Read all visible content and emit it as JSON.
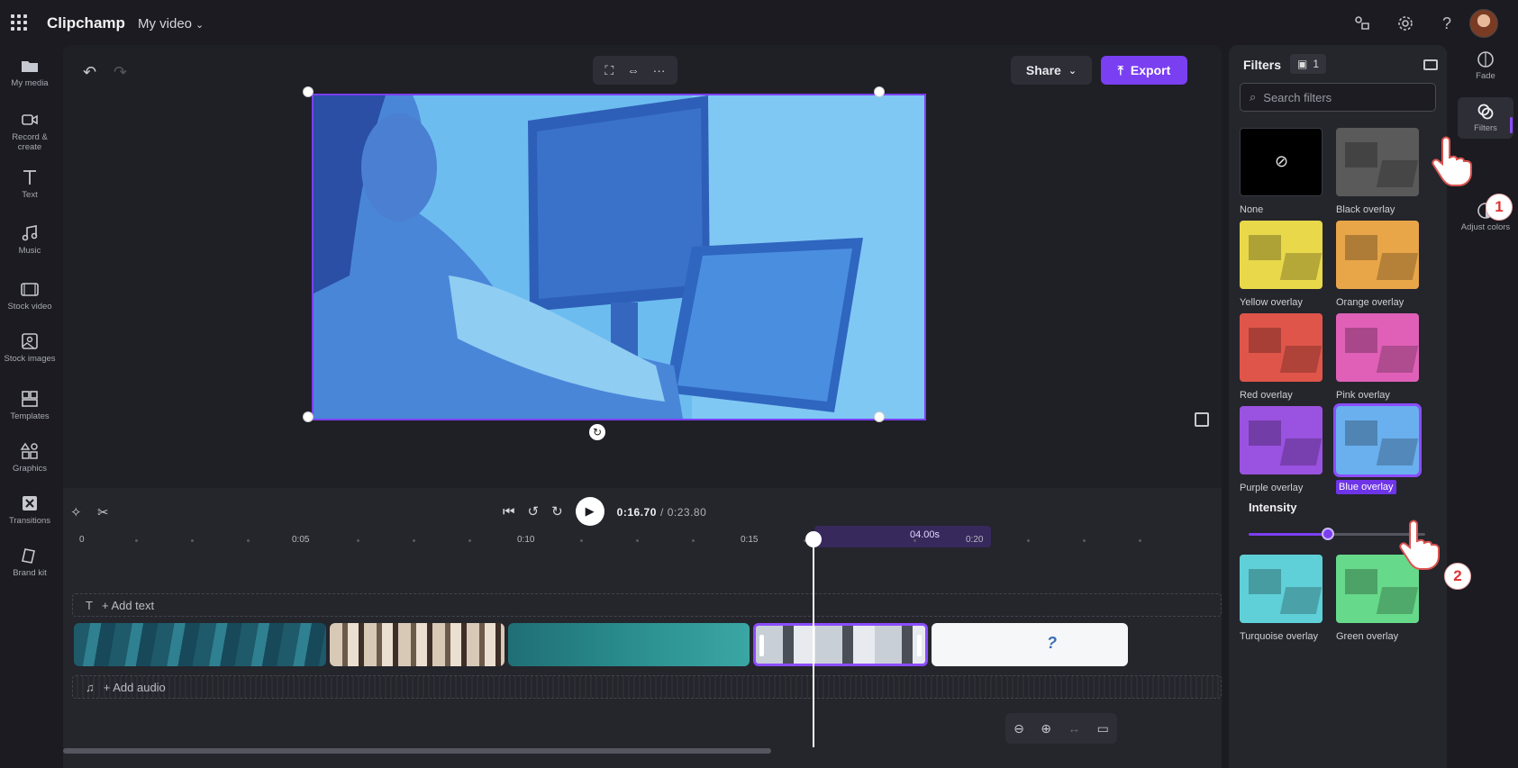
{
  "topbar": {
    "app_title": "Clipchamp",
    "video_title": "My video",
    "icons": [
      "waffle-icon",
      "feedback-icon",
      "settings-icon",
      "help-icon",
      "avatar"
    ]
  },
  "leftnav": {
    "items": [
      {
        "label": "My media",
        "icon": "folder-icon"
      },
      {
        "label": "Record & create",
        "icon": "camera-icon"
      },
      {
        "label": "Text",
        "icon": "text-icon"
      },
      {
        "label": "Music",
        "icon": "music-icon"
      },
      {
        "label": "Stock video",
        "icon": "film-icon"
      },
      {
        "label": "Stock images",
        "icon": "image-icon"
      },
      {
        "label": "Templates",
        "icon": "templates-icon"
      },
      {
        "label": "Graphics",
        "icon": "shapes-icon"
      },
      {
        "label": "Transitions",
        "icon": "transitions-icon"
      },
      {
        "label": "Brand kit",
        "icon": "brand-kit-icon"
      }
    ]
  },
  "stage": {
    "share_label": "Share",
    "export_label": "Export"
  },
  "timeline": {
    "current_time": "0:16.70",
    "total_time": "/ 0:23.80",
    "ruler": [
      "0",
      "0:05",
      "0:10",
      "0:15",
      "0:20"
    ],
    "selection_duration": "04.00s",
    "add_text": "+ Add text",
    "add_audio": "+ Add audio"
  },
  "filters_panel": {
    "title": "Filters",
    "count": "1",
    "search_placeholder": "Search filters",
    "filters": [
      {
        "label": "None",
        "color": "#000000"
      },
      {
        "label": "Black overlay",
        "color": "#5a5a5a"
      },
      {
        "label": "Yellow overlay",
        "color": "#e8d84a"
      },
      {
        "label": "Orange overlay",
        "color": "#e8a648"
      },
      {
        "label": "Red overlay",
        "color": "#e0554a"
      },
      {
        "label": "Pink overlay",
        "color": "#e060b8"
      },
      {
        "label": "Purple overlay",
        "color": "#9a52e0"
      },
      {
        "label": "Blue overlay",
        "color": "#6ab0ef"
      },
      {
        "label": "Turquoise overlay",
        "color": "#5fd0d8"
      },
      {
        "label": "Green overlay",
        "color": "#66d98a"
      }
    ],
    "selected_filter": "Blue overlay",
    "intensity_label": "Intensity",
    "intensity_value": 0.45
  },
  "rightrail": {
    "items": [
      {
        "label": "Fade",
        "icon": "fade-icon"
      },
      {
        "label": "Filters",
        "icon": "filters-icon"
      },
      {
        "label": "Adjust colors",
        "icon": "adjust-colors-icon"
      }
    ]
  },
  "annotations": {
    "step1": "1",
    "step2": "2"
  },
  "colors": {
    "accent": "#7b3ff2",
    "background": "#1b1b21",
    "panel": "#25252c"
  }
}
